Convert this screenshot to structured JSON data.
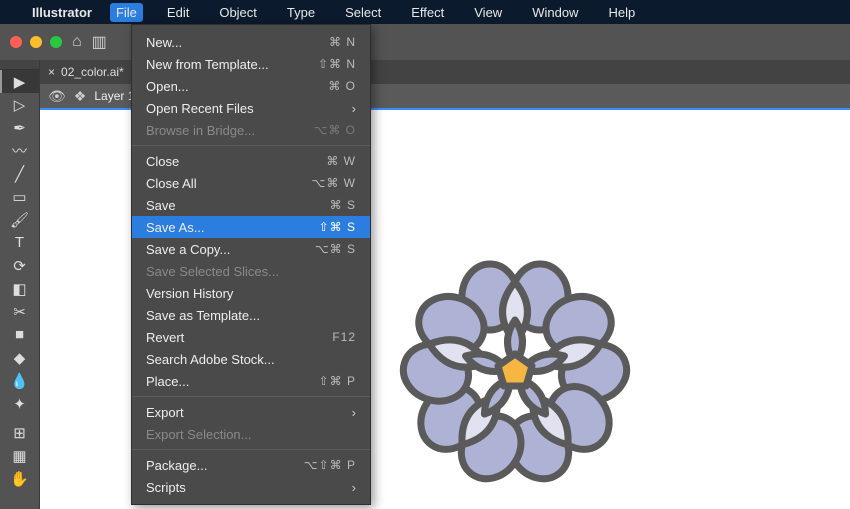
{
  "menubar": {
    "appname": "Illustrator",
    "items": [
      "File",
      "Edit",
      "Object",
      "Type",
      "Select",
      "Effect",
      "View",
      "Window",
      "Help"
    ],
    "active_index": 0
  },
  "tab": {
    "title": "02_color.ai*"
  },
  "layer": {
    "name": "Layer 1"
  },
  "file_menu": [
    {
      "label": "New...",
      "shortcut": "⌘ N"
    },
    {
      "label": "New from Template...",
      "shortcut": "⇧⌘ N"
    },
    {
      "label": "Open...",
      "shortcut": "⌘ O"
    },
    {
      "label": "Open Recent Files",
      "submenu": true
    },
    {
      "label": "Browse in Bridge...",
      "shortcut": "⌥⌘ O",
      "disabled": true
    },
    {
      "sep": true
    },
    {
      "label": "Close",
      "shortcut": "⌘ W"
    },
    {
      "label": "Close All",
      "shortcut": "⌥⌘ W"
    },
    {
      "label": "Save",
      "shortcut": "⌘ S"
    },
    {
      "label": "Save As...",
      "shortcut": "⇧⌘ S",
      "highlight": true
    },
    {
      "label": "Save a Copy...",
      "shortcut": "⌥⌘ S"
    },
    {
      "label": "Save Selected Slices...",
      "disabled": true
    },
    {
      "label": "Version History"
    },
    {
      "label": "Save as Template..."
    },
    {
      "label": "Revert",
      "shortcut": "F12"
    },
    {
      "label": "Search Adobe Stock..."
    },
    {
      "label": "Place...",
      "shortcut": "⇧⌘ P"
    },
    {
      "sep": true
    },
    {
      "label": "Export",
      "submenu": true
    },
    {
      "label": "Export Selection...",
      "disabled": true
    },
    {
      "sep": true
    },
    {
      "label": "Package...",
      "shortcut": "⌥⇧⌘ P"
    },
    {
      "label": "Scripts",
      "submenu": true
    }
  ],
  "tool_names": [
    "selection-tool",
    "direct-selection-tool",
    "pen-tool",
    "curvature-tool",
    "line-tool",
    "rectangle-tool",
    "paintbrush-tool",
    "type-tool",
    "rotate-tool",
    "eraser-tool",
    "scissors-tool",
    "gradient-tool",
    "shape-builder-tool",
    "eyedropper-tool",
    "blend-tool",
    "symbol-sprayer-tool",
    "artboard-tool",
    "hand-tool"
  ],
  "tool_glyphs": [
    "▶",
    "▷",
    "✒",
    "〰",
    "╱",
    "▭",
    "🖌",
    "T",
    "⟳",
    "◧",
    "✂",
    "■",
    "◆",
    "💧",
    "✦",
    "⊞",
    "▦",
    "✋"
  ]
}
